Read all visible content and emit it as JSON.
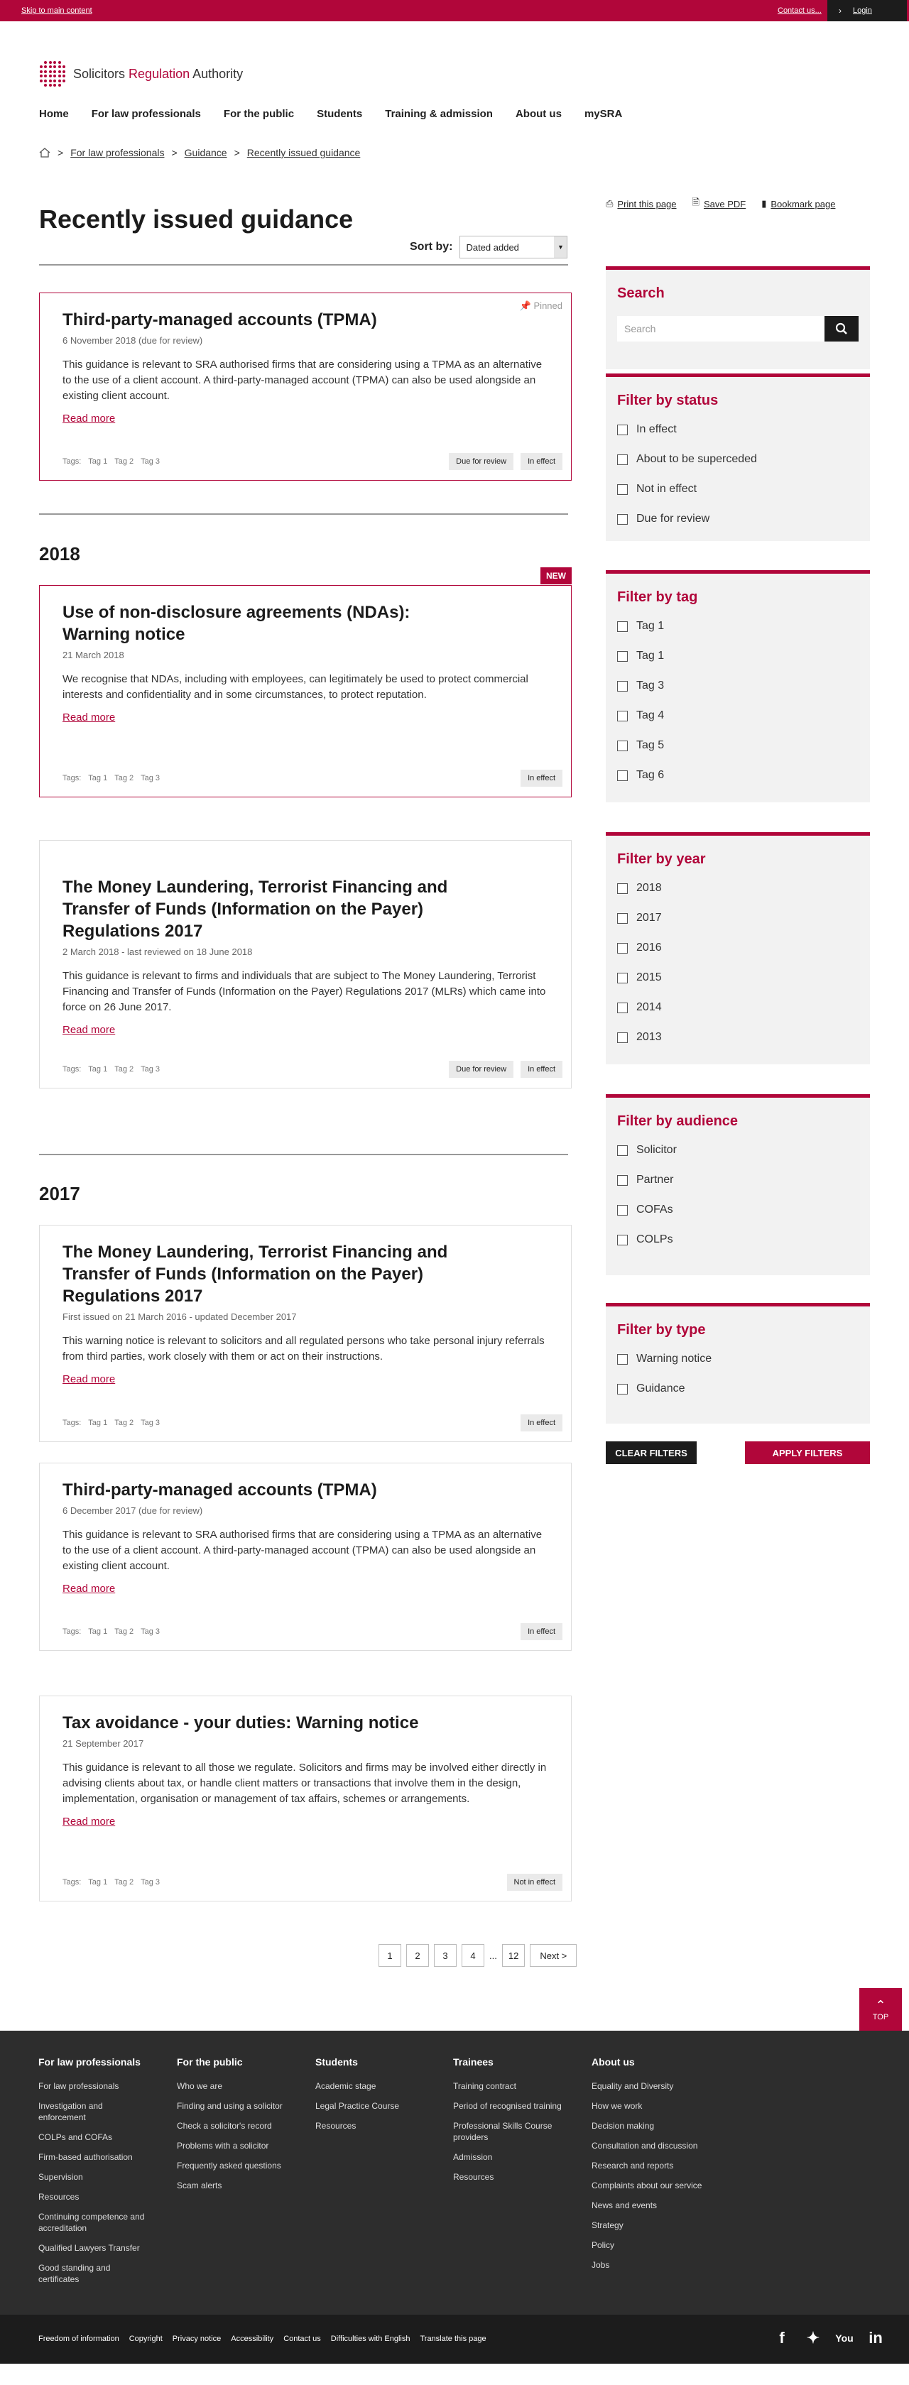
{
  "topbar": {
    "skip": "Skip to main content",
    "contact": "Contact us...",
    "login": "Login"
  },
  "logo": {
    "part1": "Solicitors",
    "part2": "Regulation",
    "part3": "Authority"
  },
  "nav": [
    "Home",
    "For law professionals",
    "For the public",
    "Students",
    "Training & admission",
    "About us",
    "mySRA"
  ],
  "breadcrumb": [
    "For law professionals",
    "Guidance",
    "Recently issued guidance"
  ],
  "page": {
    "title": "Recently issued guidance",
    "sort_label": "Sort by:",
    "sort_value": "Dated added"
  },
  "toolbar": {
    "print": "Print this page",
    "pdf": "Save PDF",
    "bookmark": "Bookmark page"
  },
  "pinned_label": "Pinned",
  "new_label": "NEW",
  "tags_label": "Tags:",
  "tag_names": [
    "Tag 1",
    "Tag 2",
    "Tag 3"
  ],
  "read_more": "Read more",
  "years": {
    "y2018": "2018",
    "y2017": "2017"
  },
  "cards": [
    {
      "title": "Third-party-managed accounts (TPMA)",
      "date": "6 November 2018 (due for review)",
      "body": "This guidance is relevant to SRA authorised firms that are considering using a TPMA as an alternative to the use of a client account. A third-party-managed account (TPMA) can also be used alongside an existing client account.",
      "badges": [
        "Due for review",
        "In effect"
      ]
    },
    {
      "title": "Use of non-disclosure agreements (NDAs): Warning notice",
      "date": "21 March 2018",
      "body": "We recognise that NDAs, including with employees, can legitimately be used to protect commercial interests and confidentiality and in some circumstances, to protect reputation.",
      "badges": [
        "In effect"
      ]
    },
    {
      "title": "The Money Laundering, Terrorist Financing and Transfer of Funds (Information on the Payer) Regulations 2017",
      "date": "2 March 2018 - last reviewed on 18 June 2018",
      "body": "This guidance is relevant to firms and individuals that are subject to The Money Laundering, Terrorist Financing and Transfer of Funds (Information on the Payer) Regulations 2017 (MLRs) which came into force on 26 June 2017.",
      "badges": [
        "Due for review",
        "In effect"
      ]
    },
    {
      "title": "The Money Laundering, Terrorist Financing and Transfer of Funds (Information on the Payer) Regulations 2017",
      "date": "First issued on 21 March 2016 - updated December 2017",
      "body": "This warning notice is relevant to solicitors and all regulated persons who take personal injury referrals from third parties, work closely with them or act on their instructions.",
      "badges": [
        "In effect"
      ]
    },
    {
      "title": "Third-party-managed accounts (TPMA)",
      "date": "6 December 2017 (due for review)",
      "body": "This guidance is relevant to SRA authorised firms that are considering using a TPMA as an alternative to the use of a client account. A third-party-managed account (TPMA) can also be used alongside an existing client account.",
      "badges": [
        "In effect"
      ]
    },
    {
      "title": "Tax avoidance - your duties: Warning notice",
      "date": "21 September 2017",
      "body": "This guidance is relevant to all those we regulate. Solicitors and firms may be involved either directly in advising clients about tax, or handle client matters or transactions that involve them in the design, implementation, organisation or management of tax affairs, schemes or arrangements.",
      "badges": [
        "Not in effect"
      ]
    }
  ],
  "sidebar": {
    "search": {
      "title": "Search",
      "placeholder": "Search"
    },
    "status": {
      "title": "Filter by status",
      "options": [
        "In effect",
        "About to be superceded",
        "Not in effect",
        "Due for review"
      ]
    },
    "tag": {
      "title": "Filter by tag",
      "options": [
        "Tag 1",
        "Tag 1",
        "Tag 3",
        "Tag 4",
        "Tag 5",
        "Tag 6"
      ]
    },
    "year": {
      "title": "Filter by year",
      "options": [
        "2018",
        "2017",
        "2016",
        "2015",
        "2014",
        "2013"
      ]
    },
    "audience": {
      "title": "Filter by audience",
      "options": [
        "Solicitor",
        "Partner",
        "COFAs",
        "COLPs"
      ]
    },
    "type": {
      "title": "Filter by type",
      "options": [
        "Warning notice",
        "Guidance"
      ]
    },
    "clear": "CLEAR FILTERS",
    "apply": "APPLY FILTERS"
  },
  "pager": {
    "pages": [
      "1",
      "2",
      "3",
      "4"
    ],
    "ellipsis": "...",
    "last": "12",
    "next": "Next >"
  },
  "totop": "TOP",
  "footer": [
    {
      "title": "For law professionals",
      "links": [
        "For law professionals",
        "Investigation and enforcement",
        "COLPs and COFAs",
        "Firm-based authorisation",
        "Supervision",
        "Resources",
        "Continuing competence and accreditation",
        "Qualified Lawyers Transfer",
        "Good standing and certificates"
      ]
    },
    {
      "title": "For the public",
      "links": [
        "Who we are",
        "Finding and using a solicitor",
        "Check a solicitor's record",
        "Problems with a solicitor",
        "Frequently asked questions",
        "Scam alerts"
      ]
    },
    {
      "title": "Students",
      "links": [
        "Academic stage",
        "Legal Practice Course",
        "Resources"
      ]
    },
    {
      "title": "Trainees",
      "links": [
        "Training contract",
        "Period of recognised training",
        "Professional Skills Course providers",
        "Admission",
        "Resources"
      ]
    },
    {
      "title": "About us",
      "links": [
        "Equality and Diversity",
        "How we work",
        "Decision making",
        "Consultation and discussion",
        "Research and reports",
        "Complaints about our service",
        "News and events",
        "Strategy",
        "Policy",
        "Jobs"
      ]
    }
  ],
  "subfooter": [
    "Freedom of information",
    "Copyright",
    "Privacy notice",
    "Accessibility",
    "Contact us",
    "Difficulties with English",
    "Translate this page"
  ],
  "social": [
    "facebook-icon",
    "twitter-icon",
    "youtube-icon",
    "linkedin-icon"
  ]
}
